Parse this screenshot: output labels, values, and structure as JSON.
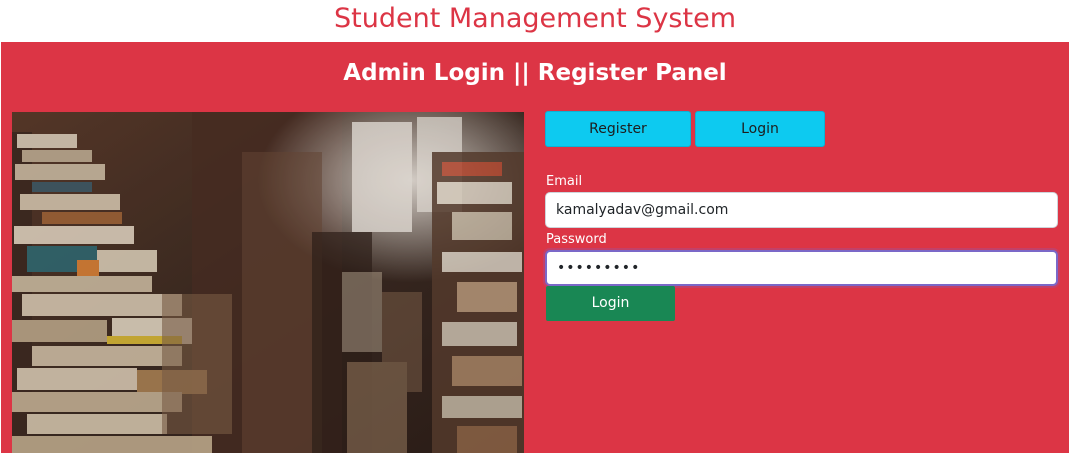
{
  "app": {
    "title": "Student Management System"
  },
  "panel": {
    "title": "Admin Login || Register Panel"
  },
  "tabs": {
    "register_label": "Register",
    "login_label": "Login"
  },
  "form": {
    "email_label": "Email",
    "email_value": "kamalyadav@gmail.com",
    "password_label": "Password",
    "password_value": "secretpw1",
    "submit_label": "Login"
  },
  "image": {
    "subject": "library-bookshelves-photo"
  },
  "colors": {
    "brand_red": "#dc3545",
    "tab_cyan": "#0dcaf0",
    "submit_green": "#198754",
    "focus_border": "#7b68c8"
  }
}
